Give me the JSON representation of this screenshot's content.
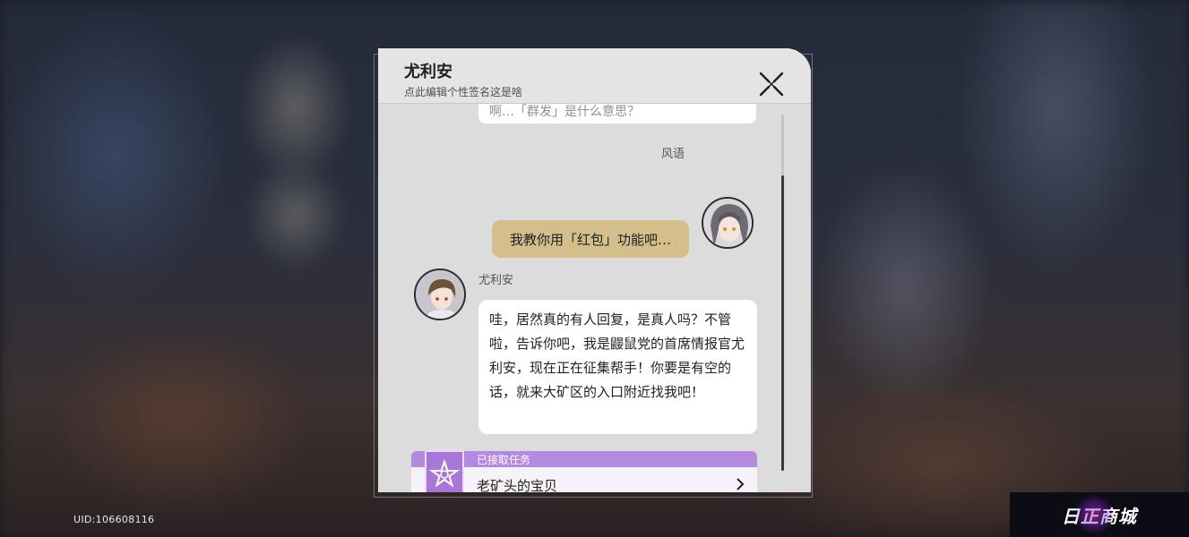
{
  "colors": {
    "dialog_bg": "#dcdcdc",
    "gold_bubble": "#d3be8c",
    "quest_accent": "#b489e0"
  },
  "uid_label": "UID:106608116",
  "watermark": {
    "text": "日正商城"
  },
  "dialog": {
    "contact_name": "尤利安",
    "signature": "点此编辑个性签名这是啥",
    "close_icon": "close-x-icon"
  },
  "messages": [
    {
      "sender": "",
      "text": "啊…「群发」是什么意思？",
      "partially_hidden": true
    },
    {
      "sender": "风语",
      "text": "我教你用「红包」功能吧…",
      "from_self": true
    },
    {
      "sender": "尤利安",
      "text": "哇，居然真的有人回复，是真人吗？不管啦，告诉你吧，我是鼹鼠党的首席情报官尤利安，现在正在征集帮手！你要是有空的话，就来大矿区的入口附近找我吧！"
    }
  ],
  "quest": {
    "status": "已接取任务",
    "title": "老矿头的宝贝",
    "icon": "quest-star-icon",
    "arrow_icon": "chevron-right-icon"
  }
}
